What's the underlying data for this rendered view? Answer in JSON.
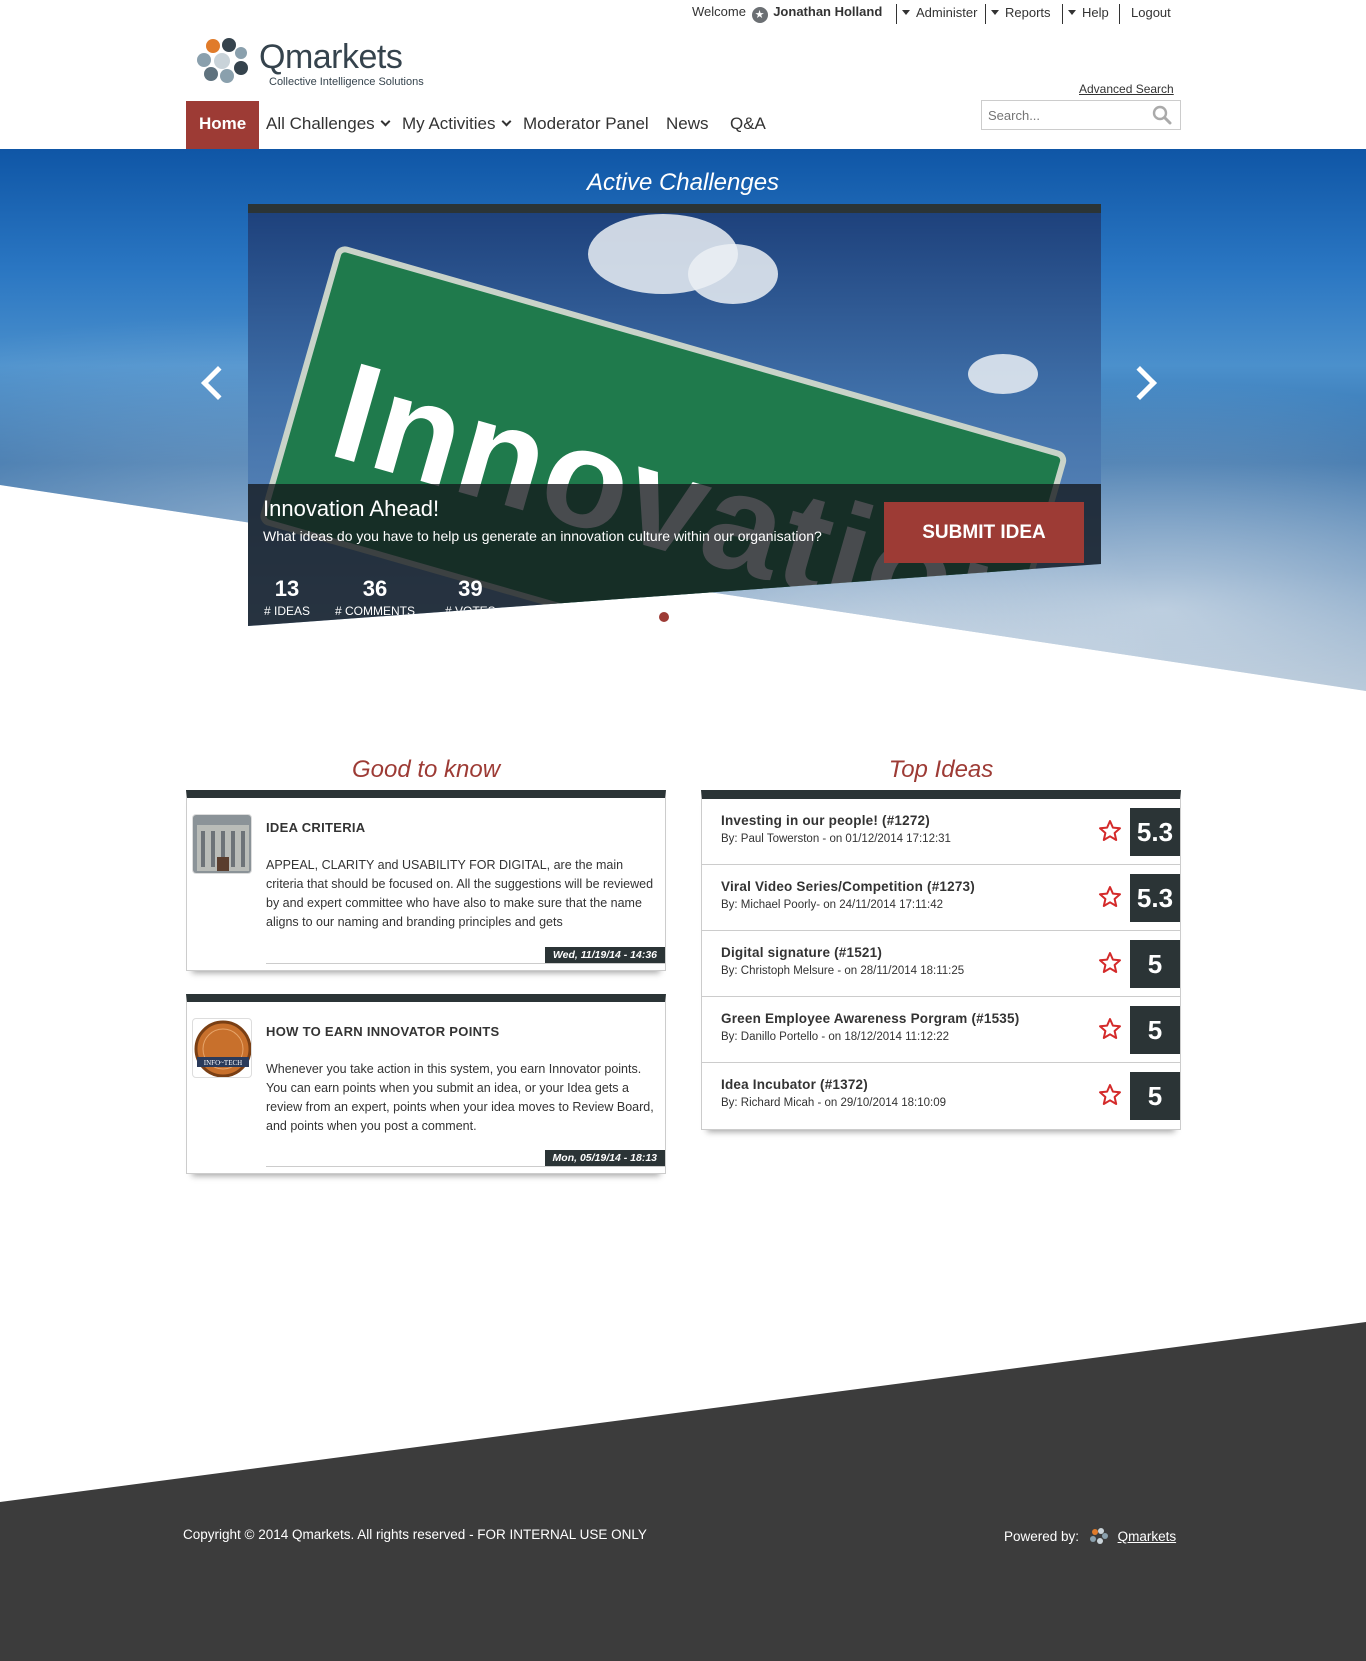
{
  "topbar": {
    "welcome": "Welcome",
    "user_name": "Jonathan Holland",
    "administer": "Administer",
    "reports": "Reports",
    "help": "Help",
    "logout": "Logout"
  },
  "logo": {
    "name": "Qmarkets",
    "tagline": "Collective Intelligence Solutions"
  },
  "search": {
    "advanced_label": "Advanced Search",
    "placeholder": "Search..."
  },
  "nav": {
    "home": "Home",
    "all_challenges": "All Challenges",
    "my_activities": "My Activities",
    "moderator_panel": "Moderator Panel",
    "news": "News",
    "qa": "Q&A"
  },
  "hero": {
    "title": "Active Challenges",
    "sign_text": "Innovation",
    "challenge_name": "Innovation Ahead!",
    "challenge_desc": "What ideas do you have to help us generate an innovation culture within our organisation?",
    "stats": [
      {
        "num": "13",
        "label": "# IDEAS"
      },
      {
        "num": "36",
        "label": "# COMMENTS"
      },
      {
        "num": "39",
        "label": "# VOTES"
      }
    ],
    "submit_label": "SUBMIT IDEA"
  },
  "good_to_know": {
    "title": "Good to know",
    "items": [
      {
        "title": "IDEA CRITERIA",
        "body": "APPEAL, CLARITY and USABILITY FOR DIGITAL, are the main criteria that should be focused on. All the suggestions will be reviewed  by and expert committee who have also to make sure that the name aligns to our naming and branding principles and gets",
        "date": "Wed, 11/19/14 - 14:36"
      },
      {
        "title": "HOW TO EARN INNOVATOR POINTS",
        "body": "Whenever you take action in this system, you earn Innovator points. You can earn points when you submit an idea, or your Idea gets a review from an expert, points when your idea moves to Review Board, and points when you post a comment.",
        "date": "Mon, 05/19/14 - 18:13",
        "badge_text": "INFO~TECH"
      }
    ]
  },
  "top_ideas": {
    "title": "Top Ideas",
    "items": [
      {
        "title": "Investing in our people! (#1272)",
        "by": "By: Paul Towerston - on 01/12/2014 17:12:31",
        "score": "5.3"
      },
      {
        "title": "Viral Video Series/Competition (#1273)",
        "by": "By: Michael Poorly- on 24/11/2014 17:11:42",
        "score": "5.3"
      },
      {
        "title": "Digital signature (#1521)",
        "by": "By: Christoph Melsure - on 28/11/2014 18:11:25",
        "score": "5"
      },
      {
        "title": "Green Employee Awareness Porgram (#1535)",
        "by": "By: Danillo Portello - on 18/12/2014 11:12:22",
        "score": "5"
      },
      {
        "title": "Idea Incubator (#1372)",
        "by": "By: Richard Micah - on 29/10/2014 18:10:09",
        "score": "5"
      }
    ]
  },
  "footer": {
    "copyright": "Copyright © 2014 Qmarkets. All rights reserved - FOR INTERNAL USE ONLY",
    "powered_by": "Powered by:",
    "powered_name": "Qmarkets"
  },
  "colors": {
    "brand_red": "#9d3b35",
    "dark_slate": "#2b3436",
    "footer": "#3c3c3c"
  }
}
